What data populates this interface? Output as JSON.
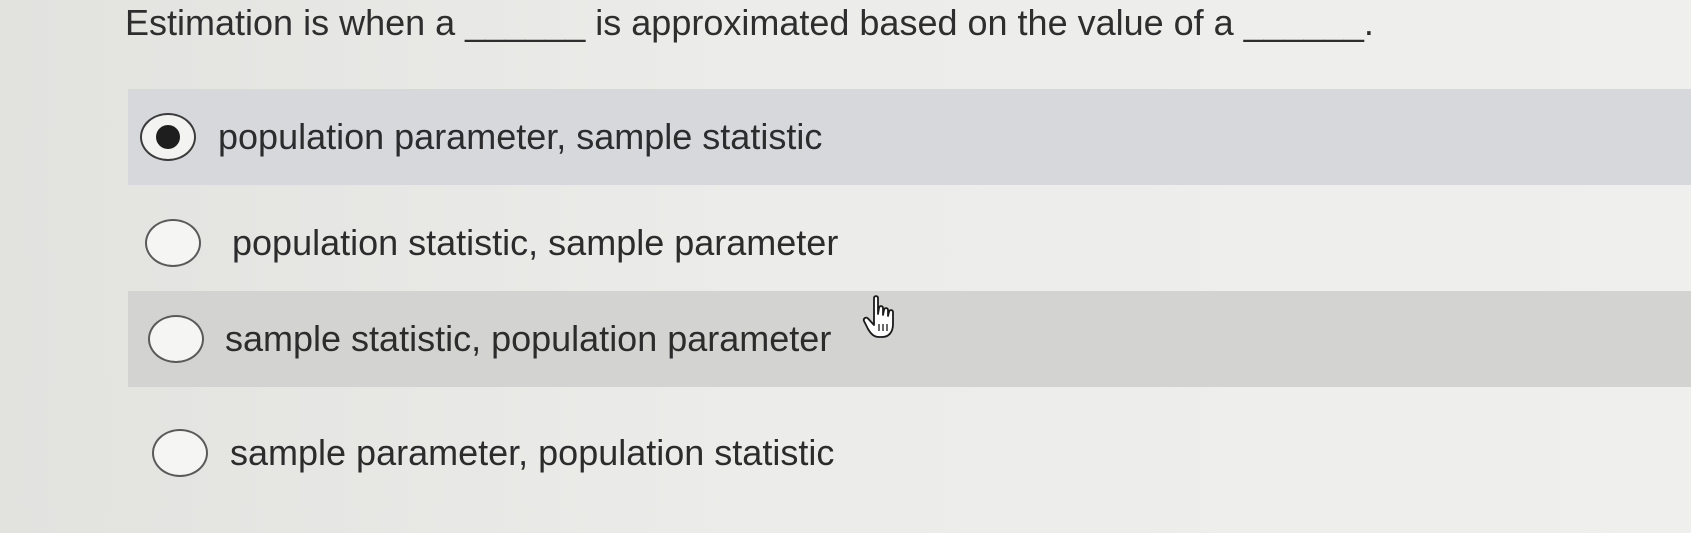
{
  "question": {
    "text": "Estimation is when a ______ is approximated based on the value of a ______."
  },
  "options": [
    {
      "label": "population parameter, sample statistic",
      "selected": true
    },
    {
      "label": "population statistic, sample parameter",
      "selected": false
    },
    {
      "label": "sample statistic, population parameter",
      "selected": false
    },
    {
      "label": "sample parameter, population statistic",
      "selected": false
    }
  ],
  "cursor": {
    "icon": "hand-pointer-icon"
  },
  "colors": {
    "selected_row": "#d6d8dc",
    "hover_row": "#d3d3d1",
    "background": "#e9e9e7"
  }
}
